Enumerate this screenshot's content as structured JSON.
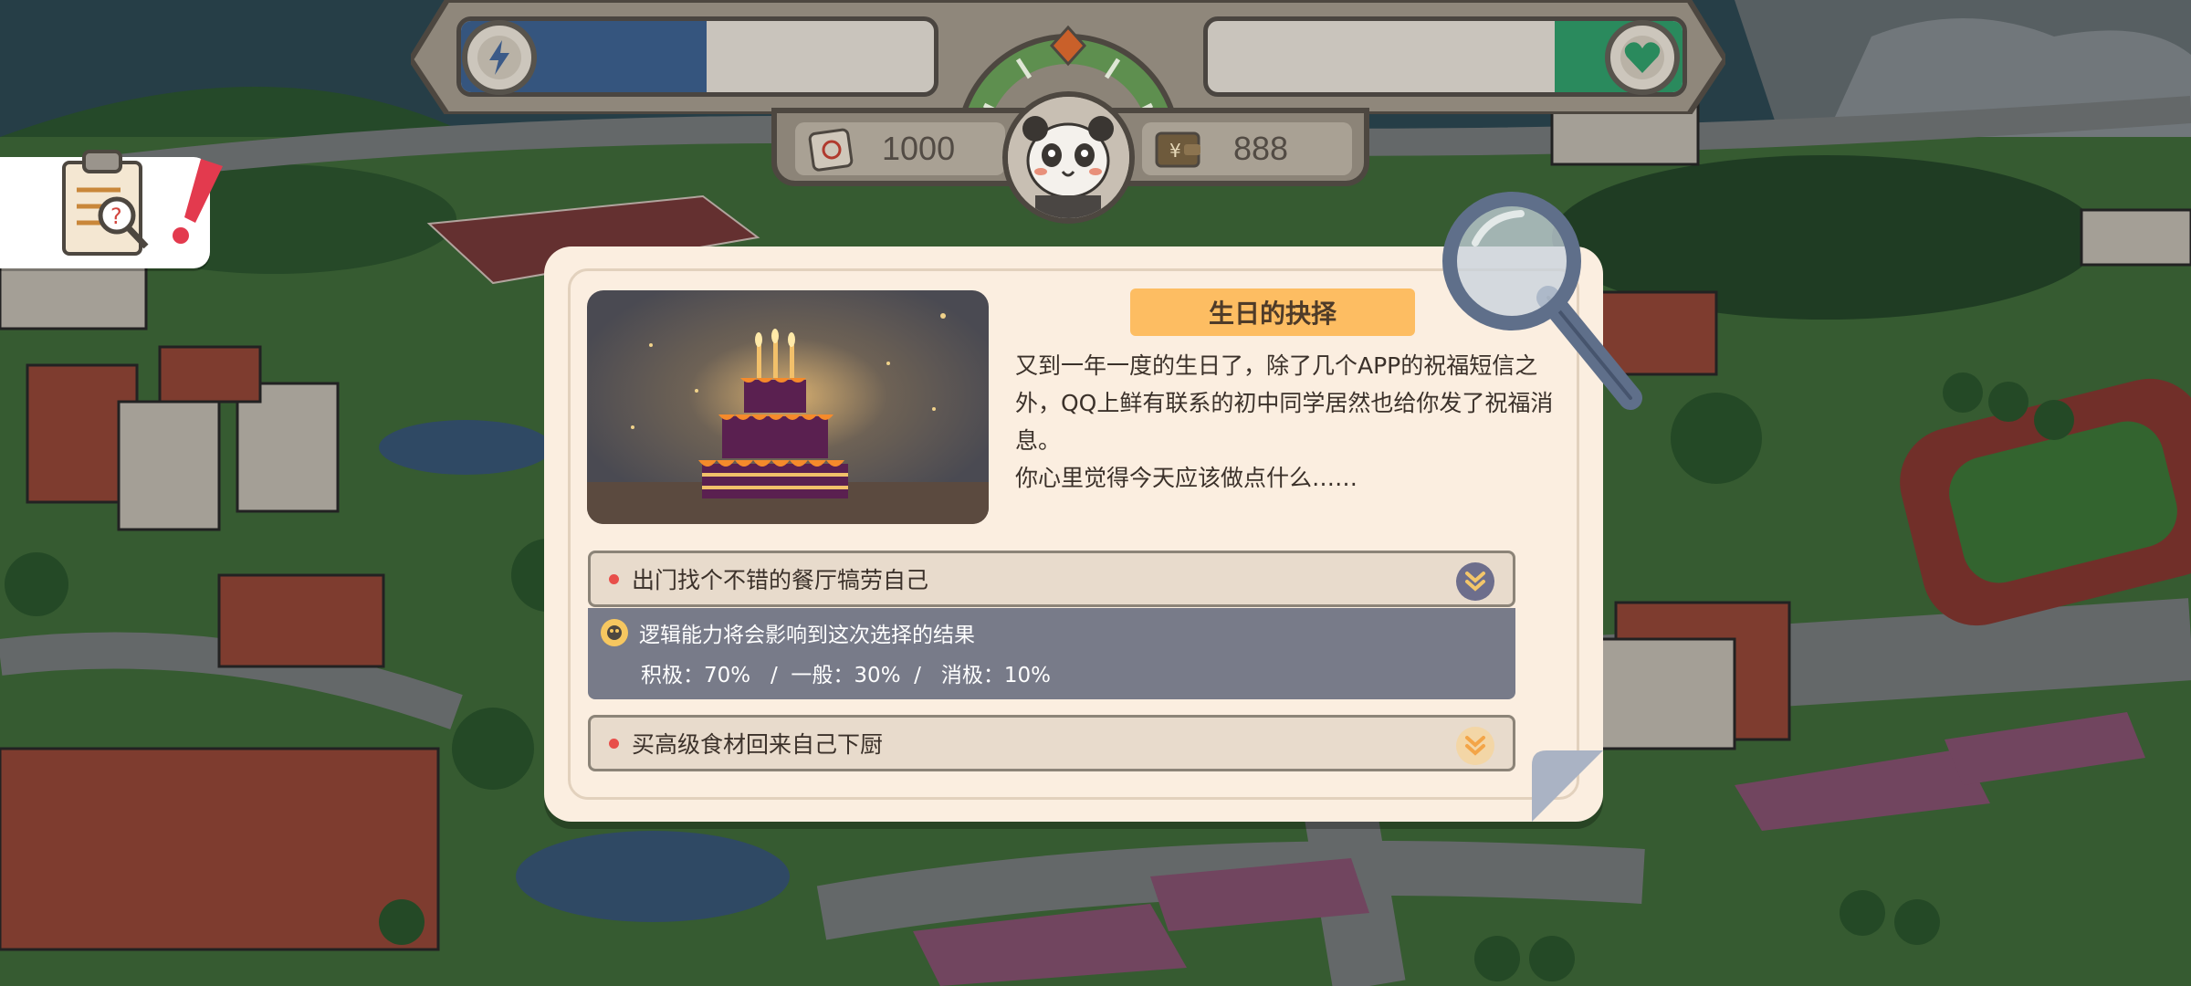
{
  "hud": {
    "energy": {
      "icon": "lightning-icon",
      "fill_fraction": 0.52,
      "color": "#35557e"
    },
    "mood": {
      "icon": "heart-icon",
      "fill_fraction": 0.27,
      "color": "#2a8a5d"
    },
    "coins": {
      "icon": "coin-scroll-icon",
      "value": "1000"
    },
    "money": {
      "icon": "wallet-icon",
      "value": "888"
    }
  },
  "task_tab": {
    "icon": "clipboard-search-icon",
    "alert_icon": "exclamation-icon"
  },
  "event": {
    "title": "生日的抉择",
    "image_icon": "birthday-cake-icon",
    "story": [
      "又到一年一度的生日了，除了几个APP的祝福短信之外，QQ上鲜有联系的初中同学居然也给你发了祝福消息。",
      "你心里觉得今天应该做点什么……"
    ],
    "choices": [
      {
        "label": "出门找个不错的餐厅犒劳自己",
        "expanded": true,
        "hint": "逻辑能力将会影响到这次选择的结果",
        "odds": "积极：70%   /  一般：30%  /   消极：10%"
      },
      {
        "label": "买高级食材回来自己下厨",
        "expanded": false
      }
    ]
  },
  "colors": {
    "card_bg": "#fbeee0",
    "title_badge": "#fdbd62",
    "detail_bg": "#787b89",
    "accent_red": "#e84f4a"
  }
}
